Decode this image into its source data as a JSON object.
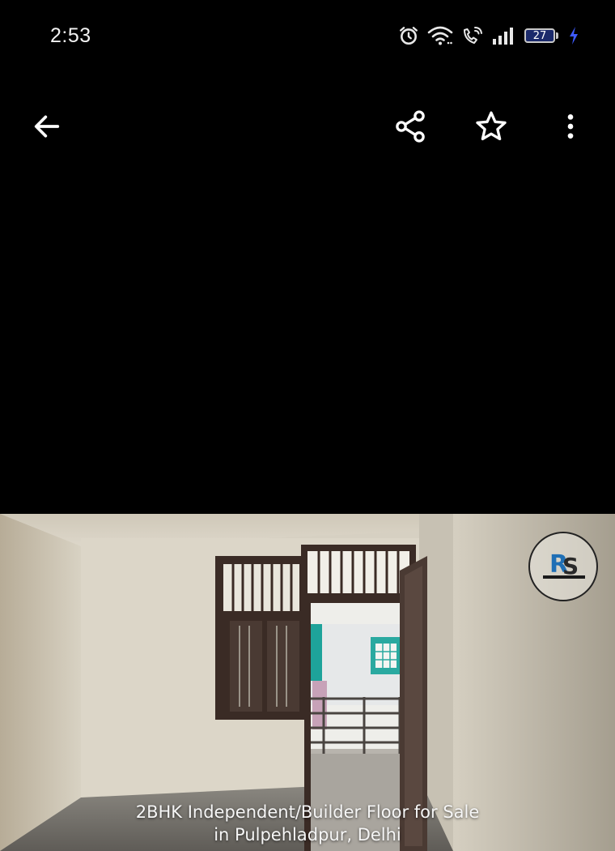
{
  "status_bar": {
    "time": "2:53",
    "battery_level": "27",
    "icons": [
      "alarm-icon",
      "wifi-icon",
      "wifi-calling-icon",
      "signal-icon",
      "battery-icon",
      "charging-bolt-icon"
    ],
    "charging_color": "#3d5afe"
  },
  "toolbar": {
    "icons": [
      "back-arrow-icon",
      "share-icon",
      "star-outline-icon",
      "more-vert-icon"
    ]
  },
  "media": {
    "caption_line1": "2BHK Independent/Builder Floor for Sale",
    "caption_line2": "in Pulpehladpur, Delhi",
    "watermark_logo": "RS Builders logo"
  },
  "colors": {
    "background": "#000000",
    "icon": "#ffffff"
  }
}
